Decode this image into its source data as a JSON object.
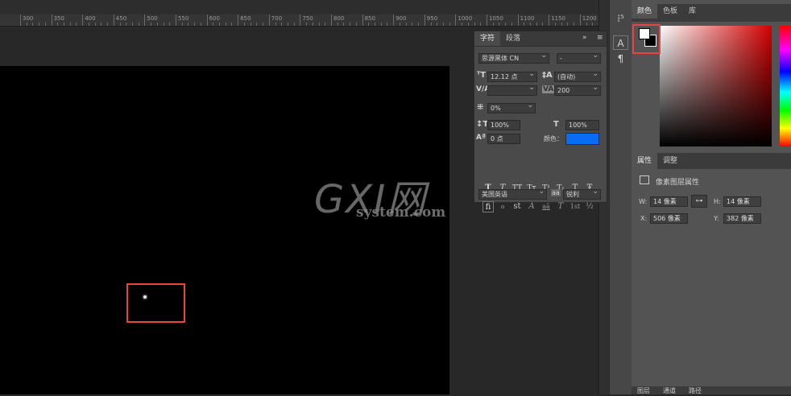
{
  "ruler": {
    "ticks": [
      "300",
      "350",
      "400",
      "450",
      "500",
      "550",
      "600",
      "650",
      "700",
      "750",
      "800",
      "850",
      "900",
      "950",
      "1000",
      "1050",
      "1100",
      "1150",
      "1200",
      "125"
    ]
  },
  "watermark": {
    "main": "GXI网",
    "sub": "system.com"
  },
  "toolbar": {
    "icons": [
      "glyph-variants-icon",
      "character-panel-icon",
      "paragraph-icon"
    ]
  },
  "character_panel": {
    "tabs": [
      "字符",
      "段落"
    ],
    "menu_glyph": "≡",
    "collapse_glyph": "»",
    "font_family": "思源黑体 CN",
    "font_style": "-",
    "font_size": "12.12 点",
    "leading": "(自动)",
    "kerning": "",
    "tracking": "200",
    "vscale_pct": "0%",
    "vertical_scale": "100%",
    "horizontal_scale": "100%",
    "baseline_shift": "0 点",
    "color_label": "颜色：",
    "color_value": "#0a6cf5",
    "style_buttons": [
      "T",
      "T",
      "TT",
      "Tт",
      "T¹",
      "T₁",
      "T",
      "Ŧ"
    ],
    "opentype_buttons": [
      "fi",
      "ℴ",
      "st",
      "A",
      "aā",
      "T",
      "1st",
      "½"
    ],
    "language": "美国英语",
    "aa_label": "aa",
    "antialias": "锐利"
  },
  "color_panel": {
    "tabs": [
      "颜色",
      "色板",
      "库"
    ]
  },
  "properties_panel": {
    "tabs": [
      "属性",
      "调整"
    ],
    "title": "像素图层属性",
    "w_label": "W:",
    "w_value": "14 像素",
    "h_label": "H:",
    "h_value": "14 像素",
    "x_label": "X:",
    "x_value": "506 像素",
    "y_label": "Y:",
    "y_value": "382 像素"
  },
  "layers_panel": {
    "tabs": [
      "图层",
      "通道",
      "路径"
    ]
  }
}
